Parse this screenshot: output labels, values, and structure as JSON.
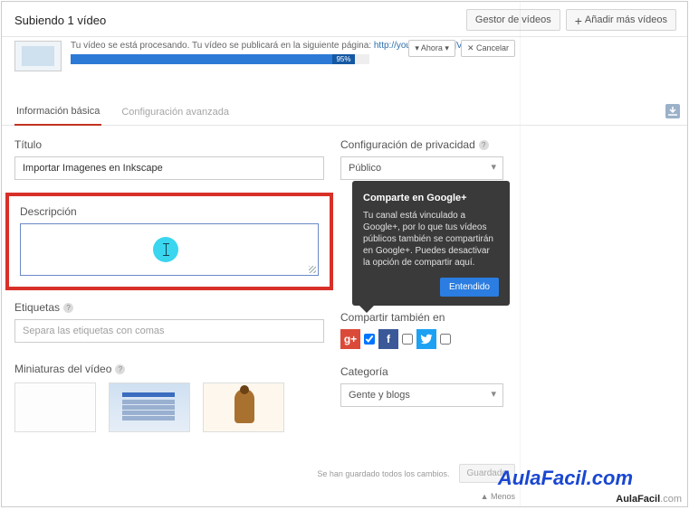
{
  "header": {
    "title": "Subiendo 1 vídeo",
    "manager_btn": "Gestor de vídeos",
    "add_btn": "Añadir más vídeos"
  },
  "status": {
    "text_prefix": "Tu vídeo se está procesando. Tu vídeo se publicará en la siguiente página: ",
    "link": "http://youtu.be/S29xjVklDn8",
    "progress_pct": "95%",
    "ahora_btn": "▾ Ahora ▾",
    "cancel_btn": "✕  Cancelar"
  },
  "tabs": {
    "basic": "Información básica",
    "advanced": "Configuración avanzada"
  },
  "fields": {
    "title_label": "Título",
    "title_value": "Importar Imagenes en Inkscape",
    "desc_label": "Descripción",
    "tags_label": "Etiquetas",
    "tags_placeholder": "Separa las etiquetas con comas",
    "thumbs_label": "Miniaturas del vídeo"
  },
  "privacy": {
    "label": "Configuración de privacidad",
    "value": "Público"
  },
  "tooltip": {
    "title": "Comparte en Google+",
    "body": "Tu canal está vinculado a Google+, por lo que tus vídeos públicos también se compartirán en Google+. Puedes desactivar la opción de compartir aquí.",
    "btn": "Entendido"
  },
  "share": {
    "label": "Compartir también en"
  },
  "category": {
    "label": "Categoría",
    "value": "Gente y blogs"
  },
  "footer": {
    "saved": "Se han guardado todos los cambios.",
    "save_btn": "Guardado",
    "menos": "▲ Menos"
  },
  "brand": {
    "big": "AulaFacil.com",
    "small_bold": "AulaFacil",
    "small_gray": ".com"
  }
}
